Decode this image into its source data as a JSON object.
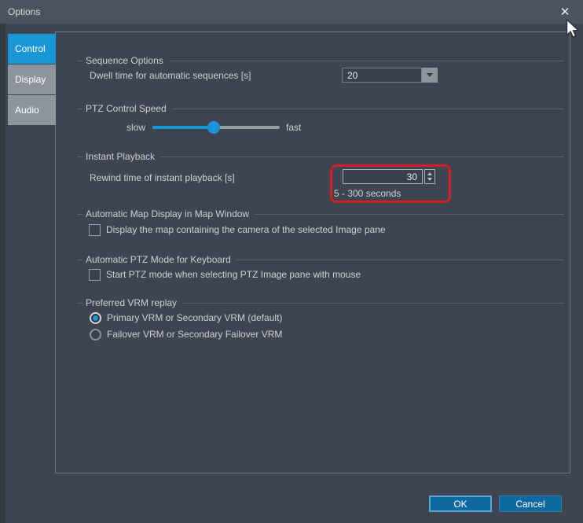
{
  "window": {
    "title": "Options",
    "close_icon": "✕"
  },
  "tabs": [
    {
      "label": "Control"
    },
    {
      "label": "Display"
    },
    {
      "label": "Audio"
    }
  ],
  "sections": {
    "sequence": {
      "heading": "Sequence Options",
      "dwell_label": "Dwell time for automatic sequences [s]",
      "dwell_value": "20"
    },
    "ptz_speed": {
      "heading": "PTZ Control Speed",
      "slow_label": "slow",
      "fast_label": "fast",
      "value_pct": 48
    },
    "instant_playback": {
      "heading": "Instant Playback",
      "rewind_label": "Rewind time of instant playback [s]",
      "rewind_value": "30",
      "range_hint": "5 - 300 seconds",
      "highlight_color": "#d11f26"
    },
    "map": {
      "heading": "Automatic Map Display in Map Window",
      "checkbox_label": "Display the map containing the camera of the selected Image pane",
      "checked": false
    },
    "ptz_keyboard": {
      "heading": "Automatic PTZ Mode for Keyboard",
      "checkbox_label": "Start PTZ mode when selecting PTZ Image pane with mouse",
      "checked": false
    },
    "vrm": {
      "heading": "Preferred VRM replay",
      "options": [
        {
          "label": "Primary VRM or Secondary VRM (default)",
          "selected": true
        },
        {
          "label": "Failover VRM or Secondary Failover VRM",
          "selected": false
        }
      ]
    }
  },
  "buttons": {
    "ok": "OK",
    "cancel": "Cancel"
  },
  "colors": {
    "accent_blue": "#1a96d4",
    "button_blue": "#0f699f",
    "highlight_red": "#d11f26"
  }
}
